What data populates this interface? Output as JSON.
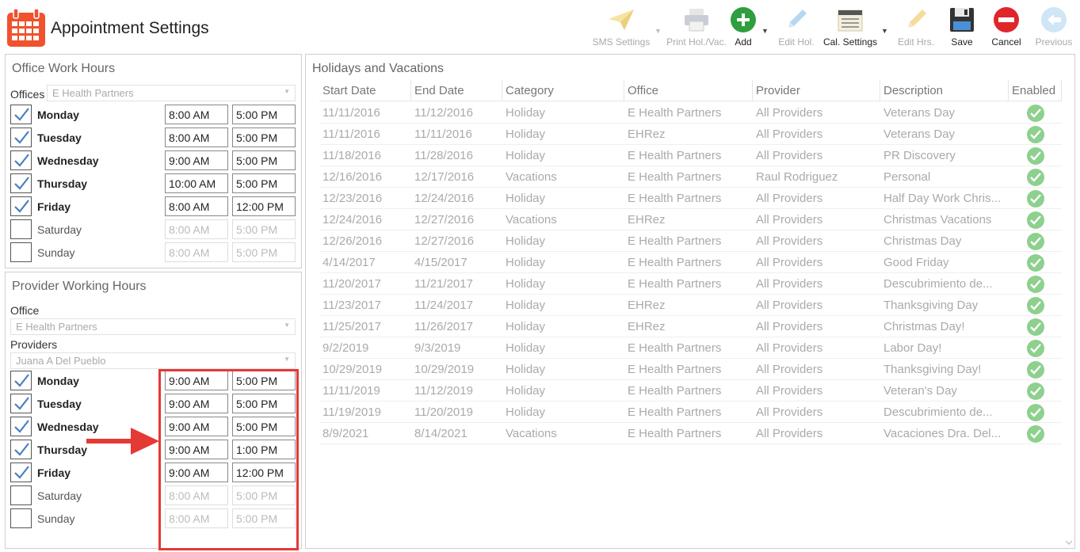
{
  "header": {
    "title": "Appointment Settings"
  },
  "toolbar": {
    "sms_settings": "SMS Settings",
    "print_hol": "Print Hol./Vac.",
    "add": "Add",
    "edit_hol": "Edit Hol.",
    "cal_settings": "Cal. Settings",
    "edit_hrs": "Edit Hrs.",
    "save": "Save",
    "cancel": "Cancel",
    "previous": "Previous"
  },
  "office_hours": {
    "title": "Office Work Hours",
    "offices_label": "Offices",
    "office_value": "E Health Partners",
    "days": [
      {
        "day": "Monday",
        "checked": true,
        "start": "8:00 AM",
        "end": "5:00 PM"
      },
      {
        "day": "Tuesday",
        "checked": true,
        "start": "8:00 AM",
        "end": "5:00 PM"
      },
      {
        "day": "Wednesday",
        "checked": true,
        "start": "9:00 AM",
        "end": "5:00 PM"
      },
      {
        "day": "Thursday",
        "checked": true,
        "start": "10:00 AM",
        "end": "5:00 PM"
      },
      {
        "day": "Friday",
        "checked": true,
        "start": "8:00 AM",
        "end": "12:00 PM"
      },
      {
        "day": "Saturday",
        "checked": false,
        "start": "8:00 AM",
        "end": "5:00 PM"
      },
      {
        "day": "Sunday",
        "checked": false,
        "start": "8:00 AM",
        "end": "5:00 PM"
      }
    ]
  },
  "provider_hours": {
    "title": "Provider Working Hours",
    "office_label": "Office",
    "office_value": "E Health Partners",
    "providers_label": "Providers",
    "provider_value": "Juana A Del Pueblo",
    "days": [
      {
        "day": "Monday",
        "checked": true,
        "start": "9:00 AM",
        "end": "5:00 PM"
      },
      {
        "day": "Tuesday",
        "checked": true,
        "start": "9:00 AM",
        "end": "5:00 PM"
      },
      {
        "day": "Wednesday",
        "checked": true,
        "start": "9:00 AM",
        "end": "5:00 PM"
      },
      {
        "day": "Thursday",
        "checked": true,
        "start": "9:00 AM",
        "end": "1:00 PM"
      },
      {
        "day": "Friday",
        "checked": true,
        "start": "9:00 AM",
        "end": "12:00 PM"
      },
      {
        "day": "Saturday",
        "checked": false,
        "start": "8:00 AM",
        "end": "5:00 PM"
      },
      {
        "day": "Sunday",
        "checked": false,
        "start": "8:00 AM",
        "end": "5:00 PM"
      }
    ]
  },
  "holidays": {
    "title": "Holidays and Vacations",
    "columns": [
      "Start Date",
      "End Date",
      "Category",
      "Office",
      "Provider",
      "Description",
      "Enabled"
    ],
    "rows": [
      [
        "11/11/2016",
        "11/12/2016",
        "Holiday",
        "E Health Partners",
        "All Providers",
        "Veterans Day"
      ],
      [
        "11/11/2016",
        "11/11/2016",
        "Holiday",
        "EHRez",
        "All Providers",
        "Veterans Day"
      ],
      [
        "11/18/2016",
        "11/28/2016",
        "Holiday",
        "E Health Partners",
        "All Providers",
        "PR Discovery"
      ],
      [
        "12/16/2016",
        "12/17/2016",
        "Vacations",
        "E Health Partners",
        "Raul Rodriguez",
        "Personal"
      ],
      [
        "12/23/2016",
        "12/24/2016",
        "Holiday",
        "E Health Partners",
        "All Providers",
        "Half Day Work Chris..."
      ],
      [
        "12/24/2016",
        "12/27/2016",
        "Vacations",
        "EHRez",
        "All Providers",
        "Christmas Vacations"
      ],
      [
        "12/26/2016",
        "12/27/2016",
        "Holiday",
        "E Health Partners",
        "All Providers",
        "Christmas Day"
      ],
      [
        "4/14/2017",
        "4/15/2017",
        "Holiday",
        "E Health Partners",
        "All Providers",
        "Good Friday"
      ],
      [
        "11/20/2017",
        "11/21/2017",
        "Holiday",
        "E Health Partners",
        "All Providers",
        "Descubrimiento de..."
      ],
      [
        "11/23/2017",
        "11/24/2017",
        "Holiday",
        "EHRez",
        "All Providers",
        "Thanksgiving Day"
      ],
      [
        "11/25/2017",
        "11/26/2017",
        "Holiday",
        "EHRez",
        "All Providers",
        "Christmas Day!"
      ],
      [
        "9/2/2019",
        "9/3/2019",
        "Holiday",
        "E Health Partners",
        "All Providers",
        "Labor Day!"
      ],
      [
        "10/29/2019",
        "10/29/2019",
        "Holiday",
        "E Health Partners",
        "All Providers",
        "Thanksgiving Day!"
      ],
      [
        "11/11/2019",
        "11/12/2019",
        "Holiday",
        "E Health Partners",
        "All Providers",
        "Veteran's Day"
      ],
      [
        "11/19/2019",
        "11/20/2019",
        "Holiday",
        "E Health Partners",
        "All Providers",
        "Descubrimiento de..."
      ],
      [
        "8/9/2021",
        "8/14/2021",
        "Vacations",
        "E Health Partners",
        "All Providers",
        "Vacaciones Dra. Del..."
      ]
    ]
  },
  "colors": {
    "accent_red": "#e53935",
    "add_green": "#2e9e3f",
    "enabled_green": "#8ed08e",
    "calendar_orange": "#f0522d"
  }
}
